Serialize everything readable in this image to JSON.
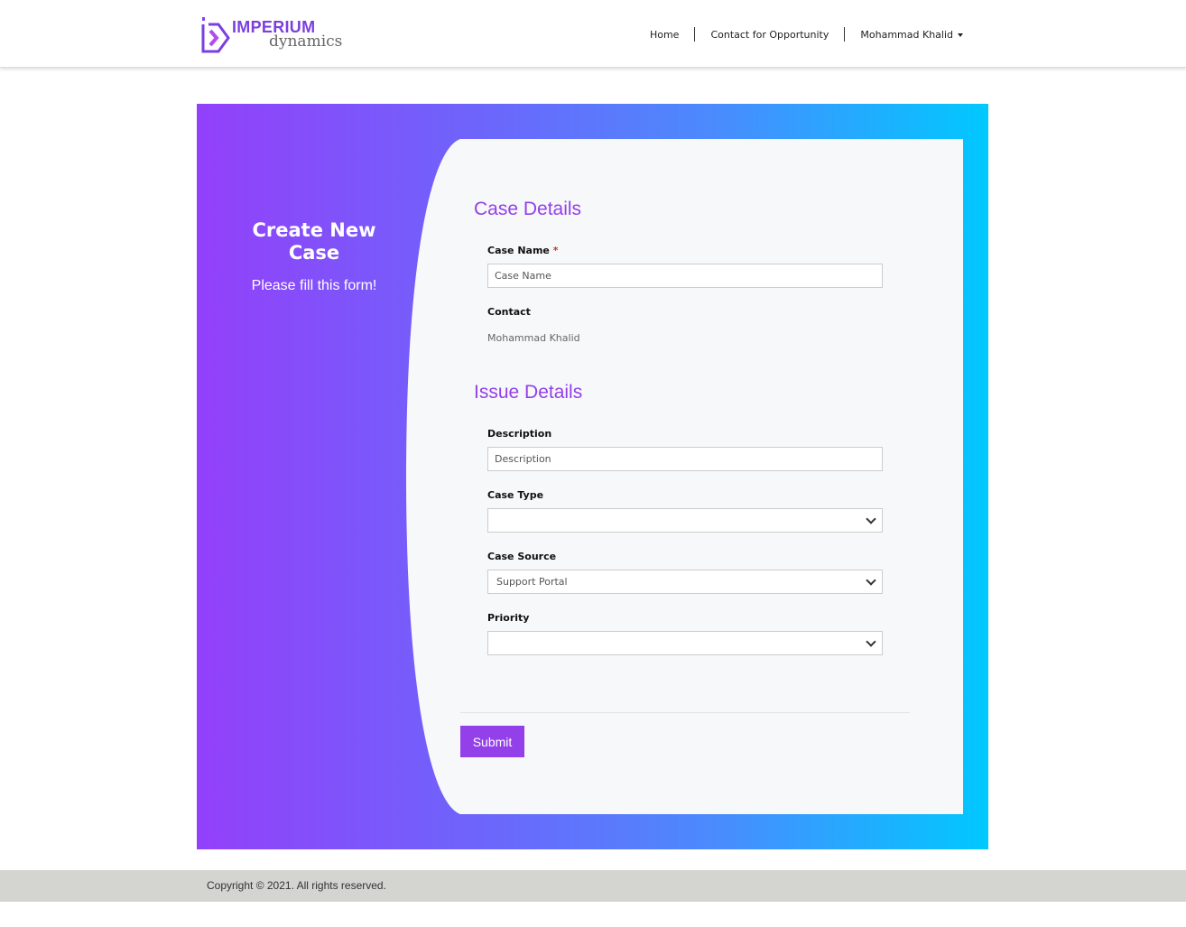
{
  "brand": {
    "name_top": "IMPERIUM",
    "name_bottom": "dynamics",
    "accent": "#9340ea"
  },
  "nav": {
    "home": "Home",
    "contact": "Contact for Opportunity",
    "user": "Mohammad Khalid"
  },
  "hero": {
    "title": "Create New Case",
    "subtitle": "Please fill this form!"
  },
  "form": {
    "case_details": "Case Details",
    "case_name_label": "Case Name",
    "required_mark": "*",
    "case_name_placeholder": "Case Name",
    "contact_label": "Contact",
    "contact_value": "Mohammad Khalid",
    "issue_details": "Issue Details",
    "description_label": "Description",
    "description_placeholder": "Description",
    "case_type_label": "Case Type",
    "case_type_value": "",
    "case_source_label": "Case Source",
    "case_source_value": "Support Portal",
    "priority_label": "Priority",
    "priority_value": "",
    "submit": "Submit"
  },
  "footer": {
    "copyright": "Copyright © 2021. All rights reserved."
  }
}
